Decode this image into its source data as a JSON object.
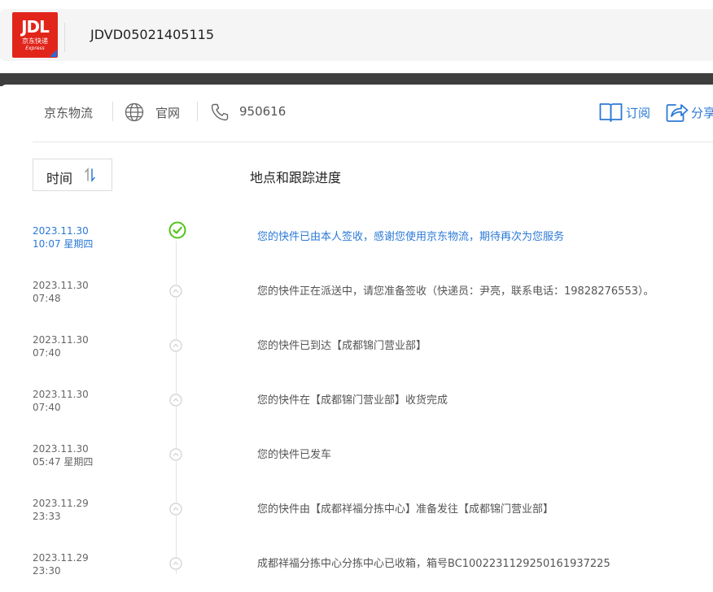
{
  "header": {
    "logo": {
      "brand": "JDL",
      "cn": "京东快递",
      "en": "Express"
    },
    "waybill_number": "JDVD05021405115"
  },
  "info_bar": {
    "company": "京东物流",
    "website_label": "官网",
    "phone": "950616",
    "subscribe_label": "订阅",
    "share_label": "分享"
  },
  "table_header": {
    "time_label": "时间",
    "progress_label": "地点和跟踪进度"
  },
  "colors": {
    "accent": "#2b79d6",
    "brand_red": "#e1251b",
    "done_green": "#52c41a"
  },
  "events": [
    {
      "date": "2023.11.30",
      "time": "10:07 星期四",
      "text": "您的快件已由本人签收，感谢您使用京东物流，期待再次为您服务",
      "status": "done"
    },
    {
      "date": "2023.11.30",
      "time": "07:48",
      "text": "您的快件正在派送中，请您准备签收（快递员：尹亮，联系电话：19828276553）。",
      "status": "passed"
    },
    {
      "date": "2023.11.30",
      "time": "07:40",
      "text": "您的快件已到达【成都锦门营业部】",
      "status": "passed"
    },
    {
      "date": "2023.11.30",
      "time": "07:40",
      "text": "您的快件在【成都锦门营业部】收货完成",
      "status": "passed"
    },
    {
      "date": "2023.11.30",
      "time": "05:47 星期四",
      "text": "您的快件已发车",
      "status": "passed"
    },
    {
      "date": "2023.11.29",
      "time": "23:33",
      "text": "您的快件由【成都祥福分拣中心】准备发往【成都锦门营业部】",
      "status": "passed"
    },
    {
      "date": "2023.11.29",
      "time": "23:30",
      "text": "成都祥福分拣中心分拣中心已收箱，箱号BC1002231129250161937225",
      "status": "passed"
    }
  ]
}
